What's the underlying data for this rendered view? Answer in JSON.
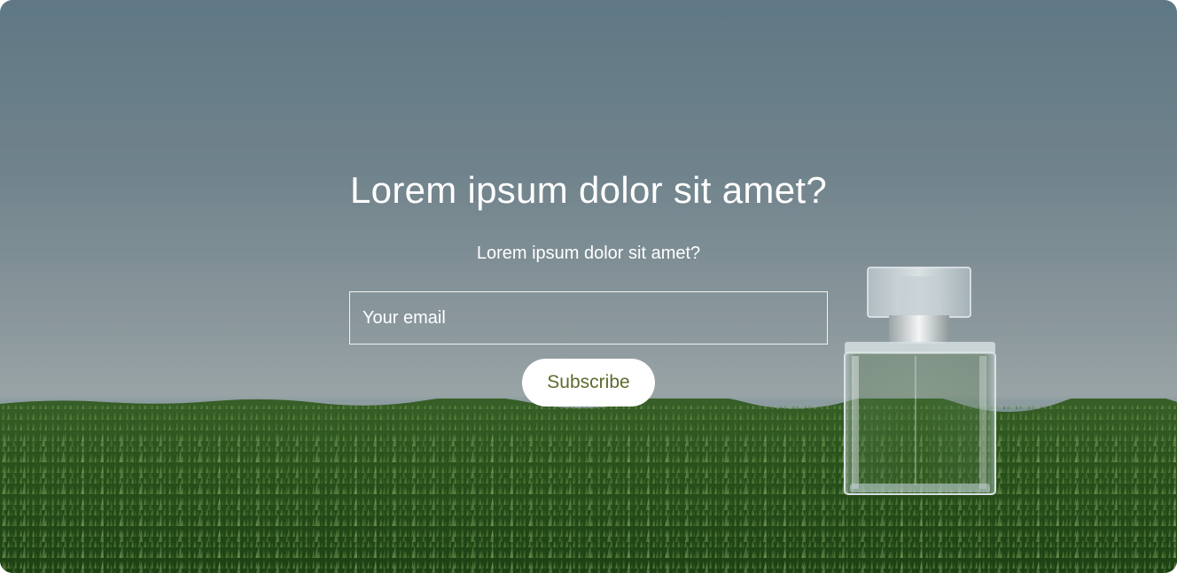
{
  "newsletter": {
    "headline": "Lorem ipsum dolor sit amet?",
    "subtitle": "Lorem ipsum dolor sit amet?",
    "email_placeholder": "Your email",
    "subscribe_label": "Subscribe"
  },
  "colors": {
    "button_text": "#5b6b2c",
    "button_bg": "#ffffff",
    "text": "#ffffff"
  }
}
